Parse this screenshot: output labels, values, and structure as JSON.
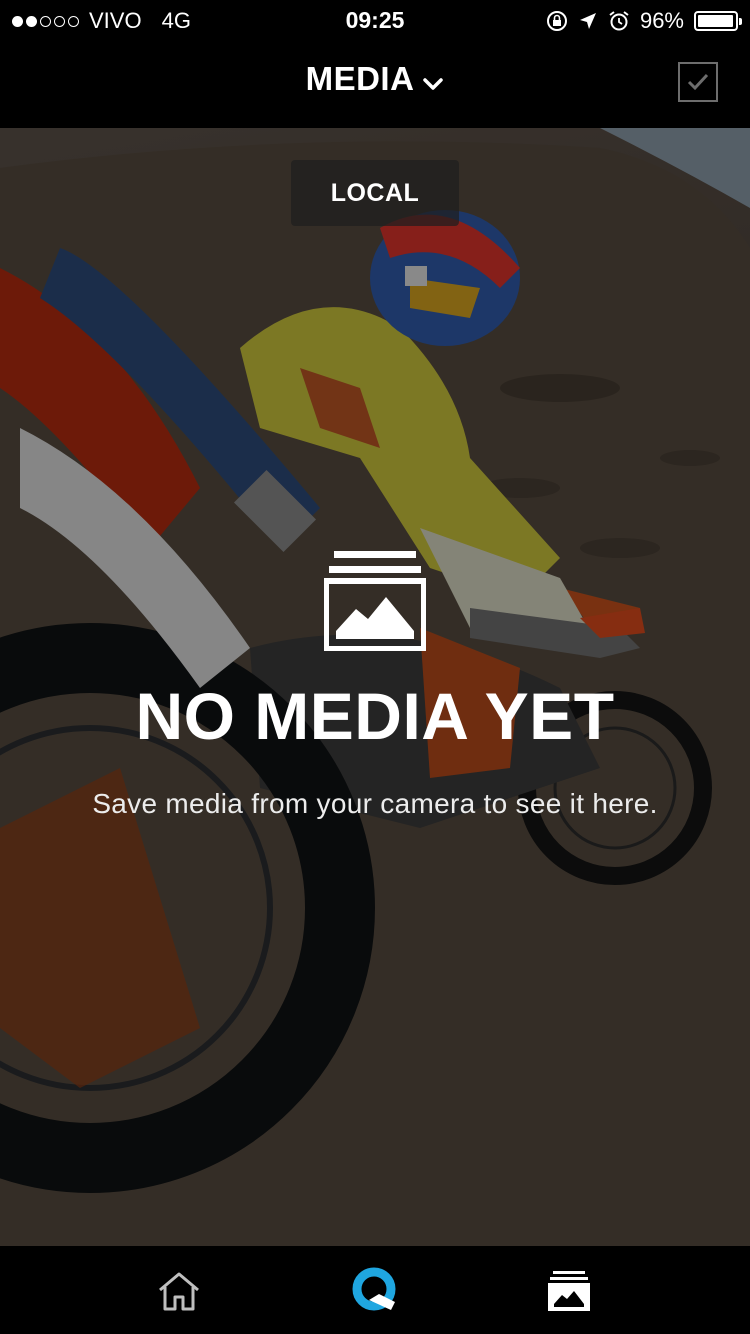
{
  "status_bar": {
    "carrier": "VIVO",
    "network": "4G",
    "time": "09:25",
    "battery_percent": "96%",
    "battery_level": 0.96,
    "signal_dots_full": 2,
    "signal_dots_total": 5
  },
  "nav": {
    "title": "MEDIA"
  },
  "filter": {
    "label": "LOCAL"
  },
  "empty_state": {
    "title": "NO MEDIA YET",
    "subtitle": "Save media from your camera to see it here."
  },
  "tabs": [
    {
      "icon": "home-icon"
    },
    {
      "icon": "quik-icon",
      "active": true,
      "color": "#1fa6e0"
    },
    {
      "icon": "media-library-icon"
    }
  ]
}
